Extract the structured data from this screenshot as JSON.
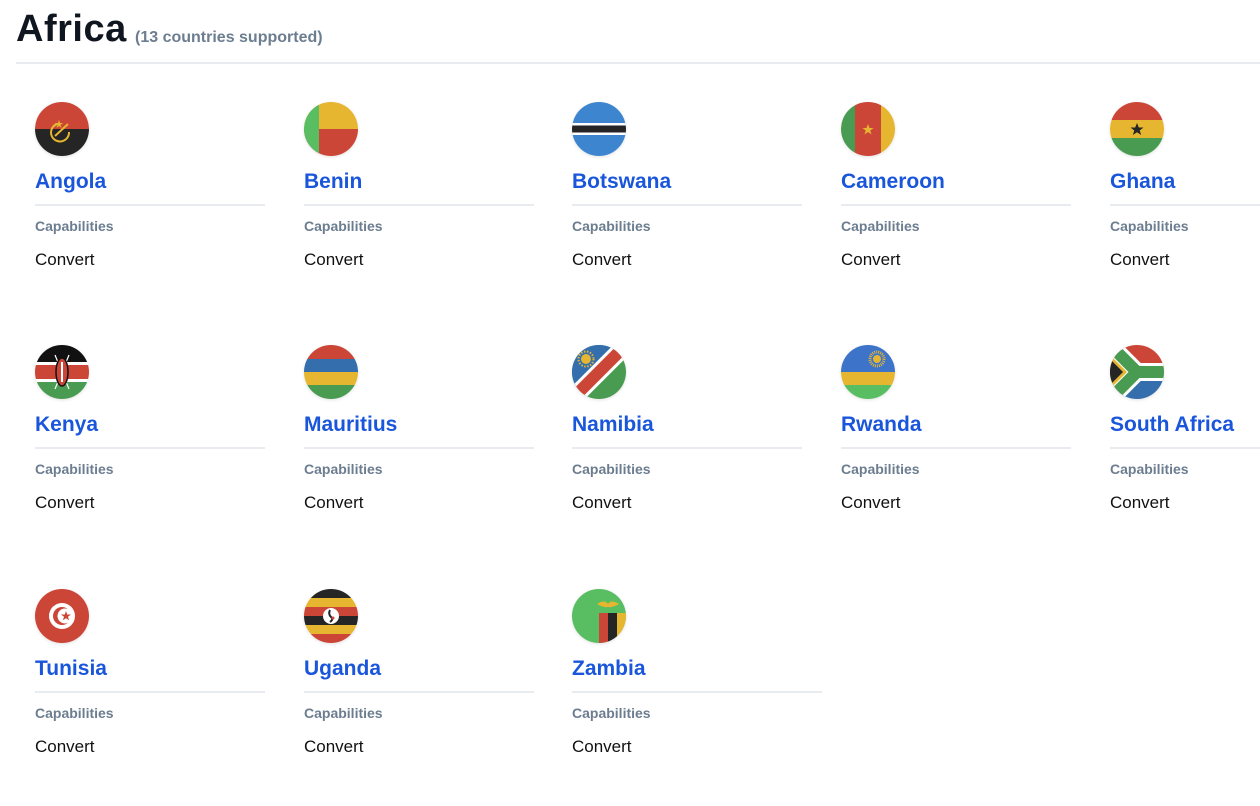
{
  "header": {
    "title": "Africa",
    "subtitle": "(13 countries supported)"
  },
  "countries": [
    {
      "name": "Angola",
      "flag_icon": "angola-flag-icon",
      "capabilities_label": "Capabilities",
      "capability": "Convert"
    },
    {
      "name": "Benin",
      "flag_icon": "benin-flag-icon",
      "capabilities_label": "Capabilities",
      "capability": "Convert"
    },
    {
      "name": "Botswana",
      "flag_icon": "botswana-flag-icon",
      "capabilities_label": "Capabilities",
      "capability": "Convert"
    },
    {
      "name": "Cameroon",
      "flag_icon": "cameroon-flag-icon",
      "capabilities_label": "Capabilities",
      "capability": "Convert"
    },
    {
      "name": "Ghana",
      "flag_icon": "ghana-flag-icon",
      "capabilities_label": "Capabilities",
      "capability": "Convert"
    },
    {
      "name": "Kenya",
      "flag_icon": "kenya-flag-icon",
      "capabilities_label": "Capabilities",
      "capability": "Convert"
    },
    {
      "name": "Mauritius",
      "flag_icon": "mauritius-flag-icon",
      "capabilities_label": "Capabilities",
      "capability": "Convert"
    },
    {
      "name": "Namibia",
      "flag_icon": "namibia-flag-icon",
      "capabilities_label": "Capabilities",
      "capability": "Convert"
    },
    {
      "name": "Rwanda",
      "flag_icon": "rwanda-flag-icon",
      "capabilities_label": "Capabilities",
      "capability": "Convert"
    },
    {
      "name": "South Africa",
      "flag_icon": "south-africa-flag-icon",
      "capabilities_label": "Capabilities",
      "capability": "Convert"
    },
    {
      "name": "Tunisia",
      "flag_icon": "tunisia-flag-icon",
      "capabilities_label": "Capabilities",
      "capability": "Convert"
    },
    {
      "name": "Uganda",
      "flag_icon": "uganda-flag-icon",
      "capabilities_label": "Capabilities",
      "capability": "Convert"
    },
    {
      "name": "Zambia",
      "flag_icon": "zambia-flag-icon",
      "capabilities_label": "Capabilities",
      "capability": "Convert"
    }
  ],
  "colors": {
    "link": "#1a56db",
    "muted": "#6c7d90",
    "red": "#cc4638",
    "yellow": "#e6b631",
    "green": "#4a9b52",
    "bright_green": "#59bd62",
    "blue": "#3d86cf",
    "dark_blue": "#356ead",
    "black": "#252525"
  }
}
